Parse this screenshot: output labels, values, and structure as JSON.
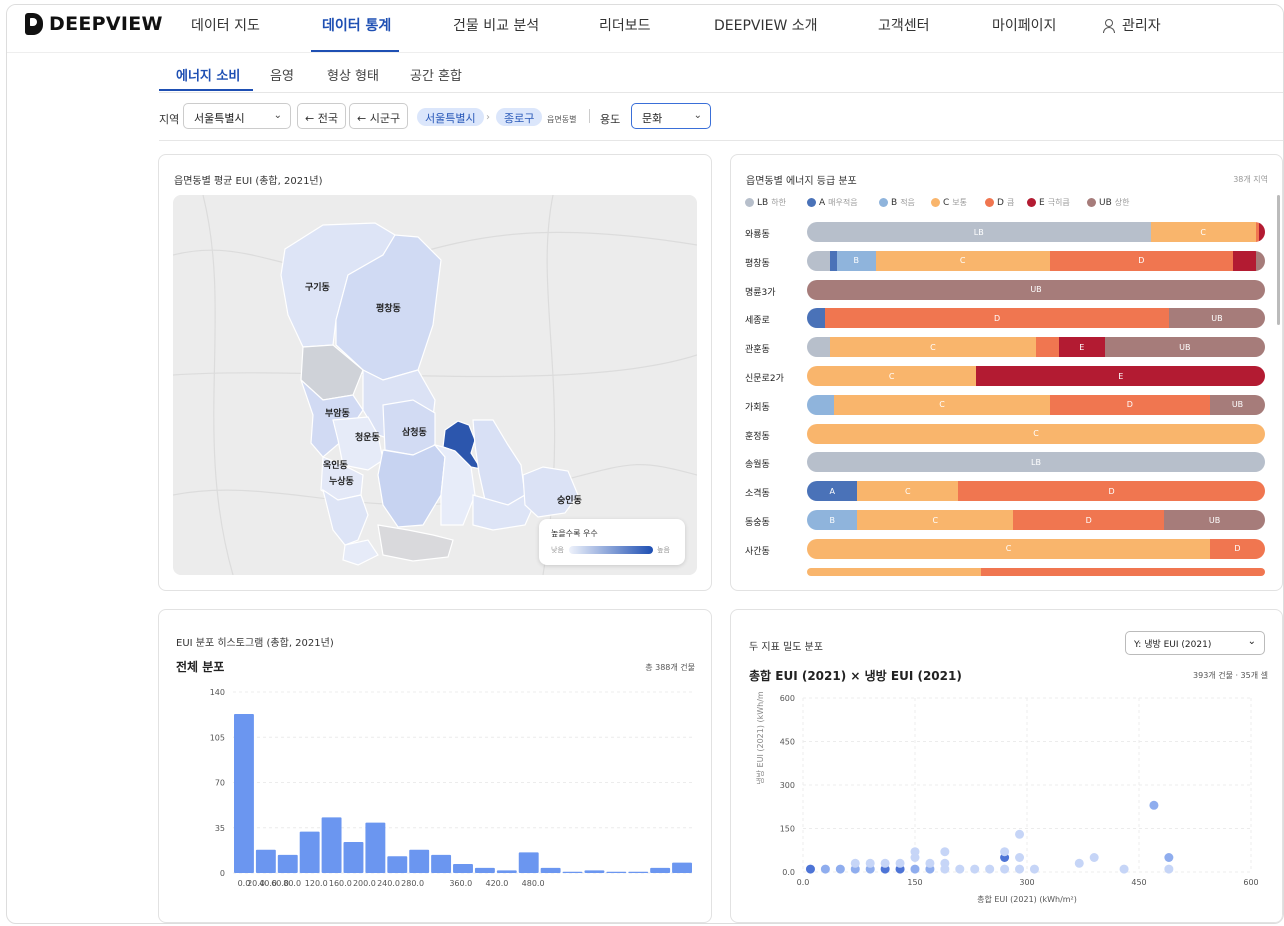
{
  "app": {
    "name": "DEEPVIEW"
  },
  "nav": {
    "items": [
      "데이터 지도",
      "데이터 통계",
      "건물 비교 분석",
      "리더보드",
      "DEEPVIEW 소개",
      "고객센터",
      "마이페이지"
    ],
    "user": "관리자"
  },
  "subtabs": [
    "에너지 소비",
    "음영",
    "형상 형태",
    "공간 혼합"
  ],
  "filters": {
    "region_label": "지역",
    "region_value": "서울특별시",
    "back_nation": "← 전국",
    "back_district": "← 시군구",
    "crumb_city": "서울특별시",
    "crumb_gu": "종로구",
    "crumb_dong": "읍면동별",
    "use_label": "용도",
    "use_value": "문화",
    "chevron": "⌄",
    "arrow": "›"
  },
  "map_card": {
    "title": "읍면동별 평균 EUI (총합, 2021년)",
    "labels": [
      "구기동",
      "평창동",
      "부암동",
      "청운동",
      "삼청동",
      "옥인동",
      "누상동",
      "숭인동"
    ],
    "legend_title": "높을수록 우수",
    "legend_low": "낮음",
    "legend_high": "높음"
  },
  "grade_card": {
    "title": "읍면동별 에너지 등급 분포",
    "count": "38개 지역",
    "legend": [
      {
        "code": "LB",
        "name": "하한",
        "color": "#b7bfcb"
      },
      {
        "code": "A",
        "name": "매우적음",
        "color": "#4a72b8"
      },
      {
        "code": "B",
        "name": "적음",
        "color": "#8fb4dc"
      },
      {
        "code": "C",
        "name": "보통",
        "color": "#f9b56c"
      },
      {
        "code": "D",
        "name": "큼",
        "color": "#f07650"
      },
      {
        "code": "E",
        "name": "극히큼",
        "color": "#b31b32"
      },
      {
        "code": "UB",
        "name": "상한",
        "color": "#a67c7a"
      }
    ],
    "rows": [
      {
        "name": "와룡동",
        "segs": [
          [
            "LB",
            75,
            "LB"
          ],
          [
            "C",
            23,
            "C"
          ],
          [
            "D",
            0.7,
            ""
          ],
          [
            "E",
            1.3,
            ""
          ]
        ]
      },
      {
        "name": "평창동",
        "segs": [
          [
            "LB",
            5,
            ""
          ],
          [
            "A",
            1.5,
            ""
          ],
          [
            "B",
            8.5,
            "B"
          ],
          [
            "C",
            38,
            "C"
          ],
          [
            "D",
            40,
            "D"
          ],
          [
            "E",
            5,
            ""
          ],
          [
            "UB",
            2,
            ""
          ]
        ]
      },
      {
        "name": "명륜3가",
        "segs": [
          [
            "UB",
            100,
            "UB"
          ]
        ]
      },
      {
        "name": "세종로",
        "segs": [
          [
            "A",
            4,
            ""
          ],
          [
            "D",
            75,
            "D"
          ],
          [
            "UB",
            21,
            "UB"
          ]
        ]
      },
      {
        "name": "관훈동",
        "segs": [
          [
            "LB",
            5,
            ""
          ],
          [
            "C",
            45,
            "C"
          ],
          [
            "D",
            5,
            ""
          ],
          [
            "E",
            10,
            "E"
          ],
          [
            "UB",
            35,
            "UB"
          ]
        ]
      },
      {
        "name": "신문로2가",
        "segs": [
          [
            "C",
            37,
            "C"
          ],
          [
            "E",
            63,
            "E"
          ]
        ]
      },
      {
        "name": "가회동",
        "segs": [
          [
            "B",
            6,
            ""
          ],
          [
            "C",
            47,
            "C"
          ],
          [
            "D",
            35,
            "D"
          ],
          [
            "UB",
            12,
            "UB"
          ]
        ]
      },
      {
        "name": "훈정동",
        "segs": [
          [
            "C",
            100,
            "C"
          ]
        ]
      },
      {
        "name": "송월동",
        "segs": [
          [
            "LB",
            100,
            "LB"
          ]
        ]
      },
      {
        "name": "소격동",
        "segs": [
          [
            "A",
            11,
            "A"
          ],
          [
            "C",
            22,
            "C"
          ],
          [
            "D",
            67,
            "D"
          ]
        ]
      },
      {
        "name": "동숭동",
        "segs": [
          [
            "B",
            11,
            "B"
          ],
          [
            "C",
            34,
            "C"
          ],
          [
            "D",
            33,
            "D"
          ],
          [
            "UB",
            22,
            "UB"
          ]
        ]
      },
      {
        "name": "사간동",
        "segs": [
          [
            "C",
            88,
            "C"
          ],
          [
            "D",
            12,
            "D"
          ]
        ]
      },
      {
        "name": "",
        "segs": [
          [
            "C",
            38,
            ""
          ],
          [
            "D",
            62,
            ""
          ]
        ]
      }
    ]
  },
  "hist_card": {
    "title": "EUI 분포 히스토그램 (총합, 2021년)",
    "subtitle": "전체 분포",
    "total": "총 388개 건물"
  },
  "scatter_card": {
    "title": "두 지표 밀도 분포",
    "dropdown": "Y: 냉방 EUI (2021)",
    "chart_title": "총합 EUI (2021) × 냉방 EUI (2021)",
    "count": "393개 건물 · 35개 셀"
  },
  "chart_data": [
    {
      "type": "bar",
      "title": "전체 분포",
      "xlabel": "",
      "ylabel": "",
      "ylim": [
        0,
        140
      ],
      "yticks": [
        0,
        35,
        70,
        105,
        140
      ],
      "xticks": [
        "0.0",
        "20.0",
        "40.0",
        "60.0",
        "80.0",
        "120.0",
        "160.0",
        "200.0",
        "240.0",
        "280.0",
        "360.0",
        "420.0",
        "480.0"
      ],
      "x": [
        0,
        20,
        40,
        60,
        80,
        100,
        120,
        140,
        160,
        180,
        200,
        220,
        240,
        260,
        280,
        300,
        320,
        340,
        360,
        380,
        400
      ],
      "values": [
        123,
        18,
        14,
        32,
        43,
        24,
        39,
        13,
        18,
        14,
        7,
        4,
        2,
        16,
        4,
        1,
        2,
        1,
        1,
        4,
        8
      ],
      "color": "#6b96f0"
    },
    {
      "type": "scatter",
      "title": "총합 EUI (2021) × 냉방 EUI (2021)",
      "xlabel": "총합 EUI (2021) (kWh/m²)",
      "ylabel": "냉방 EUI (2021) (kWh/m",
      "xlim": [
        0,
        600
      ],
      "ylim": [
        0,
        600
      ],
      "xticks": [
        "0.0",
        "150",
        "300",
        "450",
        "600"
      ],
      "yticks": [
        "0.0",
        "150",
        "300",
        "450",
        "600"
      ],
      "points": [
        [
          10,
          10,
          3
        ],
        [
          30,
          10,
          2
        ],
        [
          50,
          10,
          2
        ],
        [
          70,
          10,
          2
        ],
        [
          70,
          30,
          1
        ],
        [
          90,
          10,
          2
        ],
        [
          90,
          30,
          1
        ],
        [
          110,
          10,
          3
        ],
        [
          110,
          30,
          1
        ],
        [
          130,
          10,
          3
        ],
        [
          130,
          30,
          1
        ],
        [
          150,
          10,
          2
        ],
        [
          150,
          50,
          1
        ],
        [
          150,
          70,
          1
        ],
        [
          170,
          10,
          2
        ],
        [
          170,
          30,
          1
        ],
        [
          190,
          10,
          1
        ],
        [
          190,
          30,
          1
        ],
        [
          190,
          70,
          1
        ],
        [
          210,
          10,
          1
        ],
        [
          230,
          10,
          1
        ],
        [
          250,
          10,
          1
        ],
        [
          270,
          10,
          1
        ],
        [
          270,
          50,
          3
        ],
        [
          270,
          70,
          1
        ],
        [
          290,
          10,
          1
        ],
        [
          290,
          50,
          1
        ],
        [
          290,
          130,
          1
        ],
        [
          310,
          10,
          1
        ],
        [
          370,
          30,
          1
        ],
        [
          390,
          50,
          1
        ],
        [
          430,
          10,
          1
        ],
        [
          470,
          230,
          2
        ],
        [
          490,
          10,
          1
        ],
        [
          490,
          50,
          2
        ]
      ]
    }
  ]
}
